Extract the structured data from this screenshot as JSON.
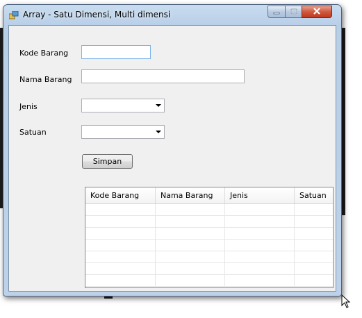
{
  "window": {
    "title": "Array - Satu Dimensi, Multi dimensi"
  },
  "form": {
    "kode_barang_label": "Kode Barang",
    "kode_barang_value": "",
    "nama_barang_label": "Nama Barang",
    "nama_barang_value": "",
    "jenis_label": "Jenis",
    "jenis_selected": "",
    "satuan_label": "Satuan",
    "satuan_selected": "",
    "simpan_label": "Simpan"
  },
  "grid": {
    "columns": [
      "Kode Barang",
      "Nama Barang",
      "Jenis",
      "Satuan"
    ],
    "rows": [
      [
        "",
        "",
        "",
        ""
      ],
      [
        "",
        "",
        "",
        ""
      ],
      [
        "",
        "",
        "",
        ""
      ],
      [
        "",
        "",
        "",
        ""
      ],
      [
        "",
        "",
        "",
        ""
      ],
      [
        "",
        "",
        "",
        ""
      ],
      [
        "",
        "",
        "",
        ""
      ]
    ]
  },
  "icons": {
    "app": "app-icon",
    "minimize": "minimize-icon",
    "maximize": "maximize-icon",
    "close": "close-icon",
    "dropdown": "chevron-down-icon",
    "cursor": "mouse-cursor-icon"
  },
  "colors": {
    "window_frame": "#b8cfe8",
    "close_button": "#cf5a3e",
    "client_bg": "#f0f0f0"
  }
}
